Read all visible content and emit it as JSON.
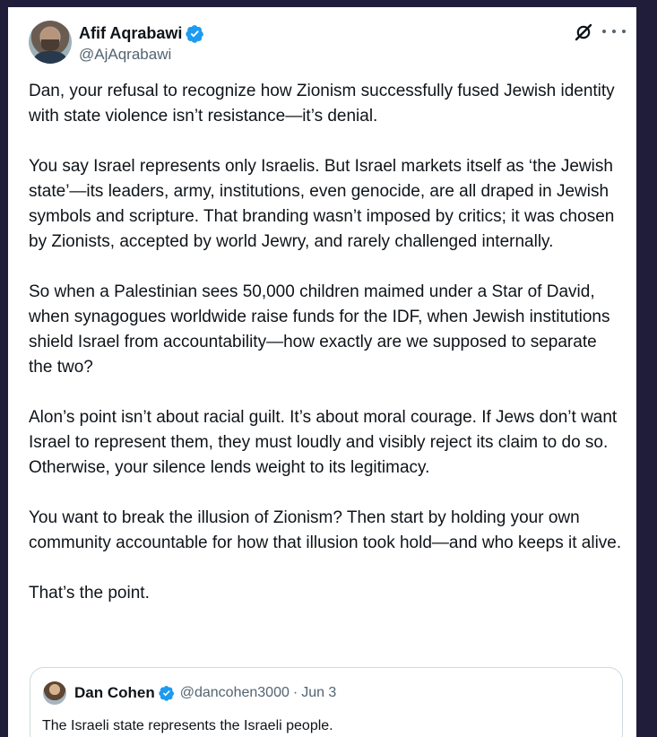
{
  "tweet": {
    "author": {
      "name": "Afif Aqrabawi",
      "handle": "@AjAqrabawi",
      "verified": true
    },
    "paragraphs": [
      "Dan, your refusal to recognize how Zionism successfully fused Jewish identity with state violence isn’t resistance—it’s denial.",
      "You say Israel represents only Israelis. But Israel markets itself as ‘the Jewish state’—its leaders, army, institutions, even genocide, are all draped in Jewish symbols and scripture. That branding wasn’t imposed by critics; it was chosen by Zionists, accepted by world Jewry, and rarely challenged internally.",
      "So when a Palestinian sees 50,000 children maimed under a Star of David, when synagogues worldwide raise funds for the IDF, when Jewish institutions shield Israel from accountability—how exactly are we supposed to separate the two?",
      "Alon’s point isn’t about racial guilt. It’s about moral courage. If Jews don’t want Israel to represent them, they must loudly and visibly reject its claim to do so. Otherwise, your silence lends weight to its legitimacy.",
      "You want to break the illusion of Zionism? Then start by holding your own community accountable for how that illusion took hold—and who keeps it alive.",
      "That’s the point."
    ]
  },
  "quoted_tweet": {
    "author": {
      "name": "Dan Cohen",
      "handle": "@dancohen3000",
      "separator": "·",
      "date": "Jun 3",
      "verified": true
    },
    "text": "The Israeli state represents the Israeli people."
  },
  "icons": {
    "verified": "verified-badge-icon",
    "grok": "grok-icon",
    "more": "more-options-icon"
  },
  "colors": {
    "background": "#1f1d3a",
    "card": "#ffffff",
    "text": "#0f1419",
    "secondary_text": "#536471",
    "verified": "#1d9bf0",
    "border": "#cfd9de"
  }
}
